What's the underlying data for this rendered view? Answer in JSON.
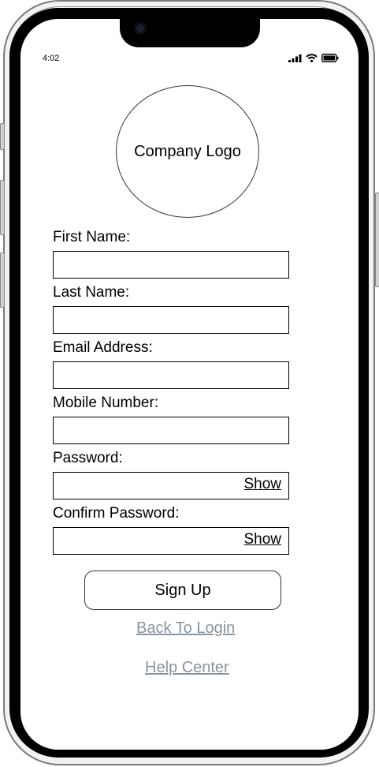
{
  "status_bar": {
    "time": "4:02",
    "icons": [
      "signal-icon",
      "wifi-icon",
      "battery-icon"
    ]
  },
  "logo": {
    "text": "Company Logo"
  },
  "form": {
    "first_name": {
      "label": "First Name:",
      "value": ""
    },
    "last_name": {
      "label": "Last Name:",
      "value": ""
    },
    "email": {
      "label": "Email Address:",
      "value": ""
    },
    "mobile": {
      "label": "Mobile Number:",
      "value": ""
    },
    "password": {
      "label": "Password:",
      "value": "",
      "toggle": "Show"
    },
    "confirm_password": {
      "label": "Confirm Password:",
      "value": "",
      "toggle": "Show"
    }
  },
  "actions": {
    "signup_label": "Sign Up",
    "back_to_login": "Back To Login",
    "help_center": "Help Center"
  },
  "colors": {
    "link": "#8a949e",
    "border": "#000000",
    "background": "#ffffff"
  }
}
